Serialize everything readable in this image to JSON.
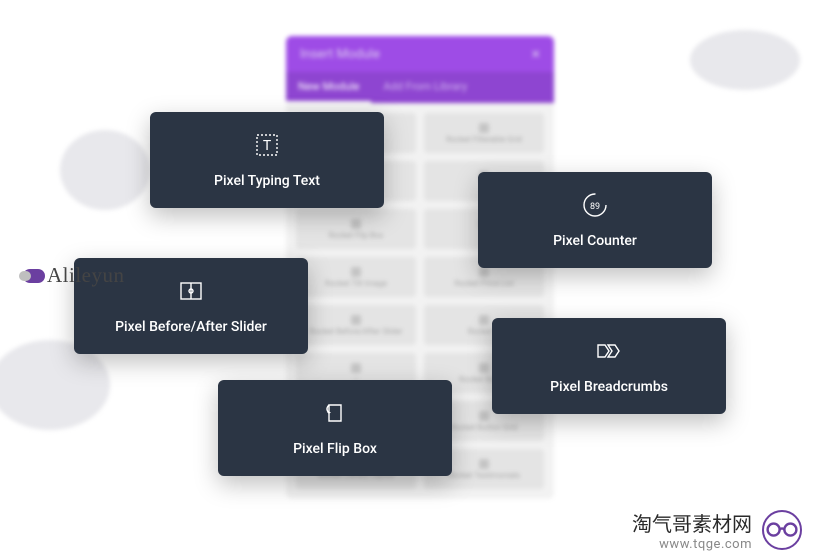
{
  "panel": {
    "title": "Insert Module",
    "tabs": [
      "New Module",
      "Add From Library"
    ],
    "modules": [
      "—",
      "Rocket Filterable Grid",
      "—",
      "—",
      "Rocket Flip Box",
      "—",
      "Rocket Tilt Image",
      "Rocket Price List",
      "Rocket Before/After Slider",
      "Rocket —",
      "—",
      "Rocket Button",
      "—",
      "Rocket Button Grid",
      "Rocket Library Layout",
      "Rocket Testimonials"
    ]
  },
  "cards": {
    "typing": "Pixel Typing Text",
    "counter": "Pixel Counter",
    "counter_value": "89",
    "slider": "Pixel Before/After Slider",
    "breadcrumbs": "Pixel Breadcrumbs",
    "flipbox": "Pixel Flip Box"
  },
  "watermark": {
    "brand": "Alileyun"
  },
  "footer": {
    "cn": "淘气哥素材网",
    "url": "www.tqge.com"
  }
}
